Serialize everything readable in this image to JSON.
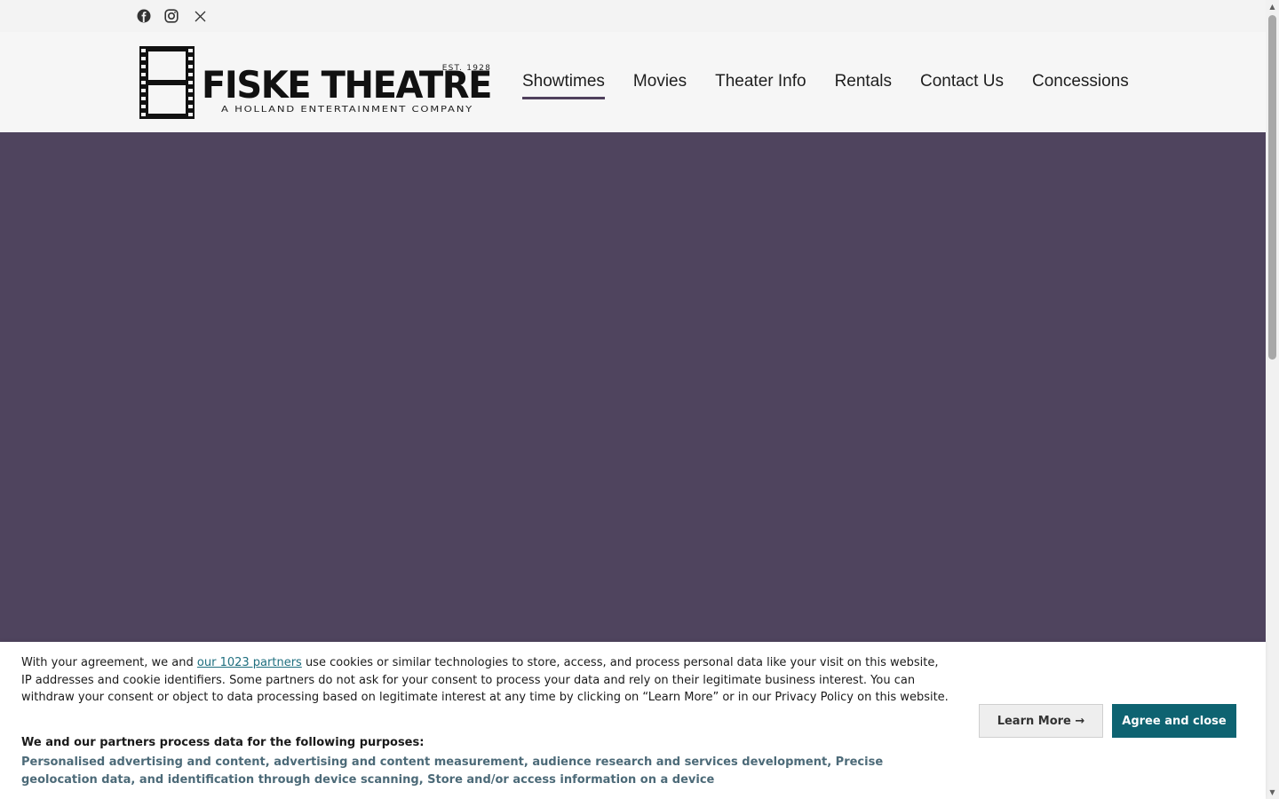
{
  "social": {
    "icons": [
      "facebook-icon",
      "instagram-icon",
      "x-twitter-icon"
    ]
  },
  "logo": {
    "name": "FISKE THEATRE",
    "established": "EST. 1928",
    "tagline": "A HOLLAND ENTERTAINMENT COMPANY"
  },
  "nav": {
    "items": [
      {
        "label": "Showtimes",
        "active": true
      },
      {
        "label": "Movies",
        "active": false
      },
      {
        "label": "Theater Info",
        "active": false
      },
      {
        "label": "Rentals",
        "active": false
      },
      {
        "label": "Contact Us",
        "active": false
      },
      {
        "label": "Concessions",
        "active": false
      }
    ]
  },
  "colors": {
    "hero_bg": "#4f445e",
    "nav_active_underline": "#4f405c",
    "agree_button": "#0e6371",
    "purposes_text": "#4c6a78"
  },
  "consent": {
    "intro_prefix": "With your agreement, we and ",
    "partners_link": "our 1023 partners",
    "intro_suffix": " use cookies or similar technologies to store, access, and process personal data like your visit on this website, IP addresses and cookie identifiers. Some partners do not ask for your consent to process your data and rely on their legitimate business interest. You can withdraw your consent or object to data processing based on legitimate interest at any time by clicking on “Learn More” or in our Privacy Policy on this website.",
    "purposes_title": "We and our partners process data for the following purposes:",
    "purposes": "Personalised advertising and content, advertising and content measurement, audience research and services development, Precise geolocation data, and identification through device scanning, Store and/or access information on a device",
    "learn_more": "Learn More →",
    "agree": "Agree and close"
  }
}
